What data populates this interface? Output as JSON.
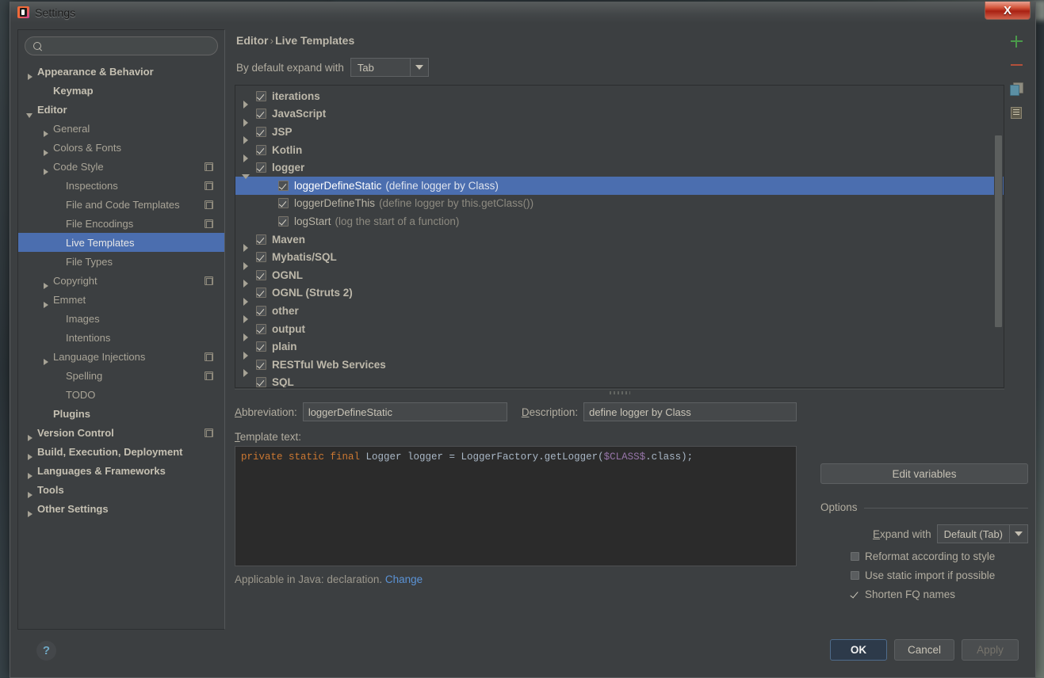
{
  "window": {
    "title": "Settings",
    "app_icon": "intellij-icon",
    "close_label": "X"
  },
  "sidebar": {
    "search": {
      "placeholder": "",
      "value": "",
      "icon": "search-icon"
    },
    "items": [
      {
        "label": "Appearance & Behavior",
        "indent": 1,
        "arrow": "closed",
        "bold": true,
        "badge": false,
        "selected": false
      },
      {
        "label": "Keymap",
        "indent": 2,
        "arrow": "none",
        "bold": true,
        "badge": false,
        "selected": false
      },
      {
        "label": "Editor",
        "indent": 1,
        "arrow": "open",
        "bold": true,
        "badge": false,
        "selected": false
      },
      {
        "label": "General",
        "indent": 2,
        "arrow": "closed",
        "bold": false,
        "badge": false,
        "selected": false
      },
      {
        "label": "Colors & Fonts",
        "indent": 2,
        "arrow": "closed",
        "bold": false,
        "badge": false,
        "selected": false
      },
      {
        "label": "Code Style",
        "indent": 2,
        "arrow": "closed",
        "bold": false,
        "badge": true,
        "selected": false
      },
      {
        "label": "Inspections",
        "indent": 3,
        "arrow": "none",
        "bold": false,
        "badge": true,
        "selected": false
      },
      {
        "label": "File and Code Templates",
        "indent": 3,
        "arrow": "none",
        "bold": false,
        "badge": true,
        "selected": false
      },
      {
        "label": "File Encodings",
        "indent": 3,
        "arrow": "none",
        "bold": false,
        "badge": true,
        "selected": false
      },
      {
        "label": "Live Templates",
        "indent": 3,
        "arrow": "none",
        "bold": false,
        "badge": false,
        "selected": true
      },
      {
        "label": "File Types",
        "indent": 3,
        "arrow": "none",
        "bold": false,
        "badge": false,
        "selected": false
      },
      {
        "label": "Copyright",
        "indent": 2,
        "arrow": "closed",
        "bold": false,
        "badge": true,
        "selected": false
      },
      {
        "label": "Emmet",
        "indent": 2,
        "arrow": "closed",
        "bold": false,
        "badge": false,
        "selected": false
      },
      {
        "label": "Images",
        "indent": 3,
        "arrow": "none",
        "bold": false,
        "badge": false,
        "selected": false
      },
      {
        "label": "Intentions",
        "indent": 3,
        "arrow": "none",
        "bold": false,
        "badge": false,
        "selected": false
      },
      {
        "label": "Language Injections",
        "indent": 2,
        "arrow": "closed",
        "bold": false,
        "badge": true,
        "selected": false
      },
      {
        "label": "Spelling",
        "indent": 3,
        "arrow": "none",
        "bold": false,
        "badge": true,
        "selected": false
      },
      {
        "label": "TODO",
        "indent": 3,
        "arrow": "none",
        "bold": false,
        "badge": false,
        "selected": false
      },
      {
        "label": "Plugins",
        "indent": 2,
        "arrow": "none",
        "bold": true,
        "badge": false,
        "selected": false
      },
      {
        "label": "Version Control",
        "indent": 1,
        "arrow": "closed",
        "bold": true,
        "badge": true,
        "selected": false
      },
      {
        "label": "Build, Execution, Deployment",
        "indent": 1,
        "arrow": "closed",
        "bold": true,
        "badge": false,
        "selected": false
      },
      {
        "label": "Languages & Frameworks",
        "indent": 1,
        "arrow": "closed",
        "bold": true,
        "badge": false,
        "selected": false
      },
      {
        "label": "Tools",
        "indent": 1,
        "arrow": "closed",
        "bold": true,
        "badge": false,
        "selected": false
      },
      {
        "label": "Other Settings",
        "indent": 1,
        "arrow": "closed",
        "bold": true,
        "badge": false,
        "selected": false
      }
    ]
  },
  "main": {
    "breadcrumb": {
      "parent": "Editor",
      "separator": "›",
      "current": "Live Templates"
    },
    "expand_with": {
      "label": "By default expand with",
      "value": "Tab"
    },
    "tree": [
      {
        "label": "iterations",
        "type": "group",
        "arrow": "closed",
        "checked": true,
        "desc": "",
        "selected": false
      },
      {
        "label": "JavaScript",
        "type": "group",
        "arrow": "closed",
        "checked": true,
        "desc": "",
        "selected": false
      },
      {
        "label": "JSP",
        "type": "group",
        "arrow": "closed",
        "checked": true,
        "desc": "",
        "selected": false
      },
      {
        "label": "Kotlin",
        "type": "group",
        "arrow": "closed",
        "checked": true,
        "desc": "",
        "selected": false
      },
      {
        "label": "logger",
        "type": "group",
        "arrow": "open",
        "checked": true,
        "desc": "",
        "selected": false
      },
      {
        "label": "loggerDefineStatic",
        "type": "leaf",
        "arrow": "none",
        "checked": true,
        "desc": "(define logger by Class)",
        "selected": true
      },
      {
        "label": "loggerDefineThis",
        "type": "leaf",
        "arrow": "none",
        "checked": true,
        "desc": "(define logger by this.getClass())",
        "selected": false
      },
      {
        "label": "logStart",
        "type": "leaf",
        "arrow": "none",
        "checked": true,
        "desc": "(log the start of a function)",
        "selected": false
      },
      {
        "label": "Maven",
        "type": "group",
        "arrow": "closed",
        "checked": true,
        "desc": "",
        "selected": false
      },
      {
        "label": "Mybatis/SQL",
        "type": "group",
        "arrow": "closed",
        "checked": true,
        "desc": "",
        "selected": false
      },
      {
        "label": "OGNL",
        "type": "group",
        "arrow": "closed",
        "checked": true,
        "desc": "",
        "selected": false
      },
      {
        "label": "OGNL (Struts 2)",
        "type": "group",
        "arrow": "closed",
        "checked": true,
        "desc": "",
        "selected": false
      },
      {
        "label": "other",
        "type": "group",
        "arrow": "closed",
        "checked": true,
        "desc": "",
        "selected": false
      },
      {
        "label": "output",
        "type": "group",
        "arrow": "closed",
        "checked": true,
        "desc": "",
        "selected": false
      },
      {
        "label": "plain",
        "type": "group",
        "arrow": "closed",
        "checked": true,
        "desc": "",
        "selected": false
      },
      {
        "label": "RESTful Web Services",
        "type": "group",
        "arrow": "closed",
        "checked": true,
        "desc": "",
        "selected": false
      },
      {
        "label": "SQL",
        "type": "group",
        "arrow": "closed",
        "checked": true,
        "desc": "",
        "selected": false
      }
    ],
    "toolbar": [
      {
        "icon": "plus-icon",
        "name": "add-template-button"
      },
      {
        "icon": "minus-icon",
        "name": "remove-template-button"
      },
      {
        "icon": "copy-icon",
        "name": "duplicate-template-button"
      },
      {
        "icon": "document-icon",
        "name": "template-group-button"
      }
    ],
    "form": {
      "abbreviation_label": "Abbreviation:",
      "abbreviation_value": "loggerDefineStatic",
      "description_label": "Description:",
      "description_value": "define logger by Class",
      "template_text_label": "Template text:",
      "template_code": {
        "keywords": "private static final ",
        "part2": "Logger logger = LoggerFactory.getLogger(",
        "variable": "$CLASS$",
        "part3": ".class);"
      },
      "applicable_text": "Applicable in Java: declaration.",
      "applicable_link": "Change"
    },
    "options": {
      "edit_variables_label": "Edit variables",
      "group_label": "Options",
      "expand_with_label": "Expand with",
      "expand_with_value": "Default (Tab)",
      "checkboxes": [
        {
          "label": "Reformat according to style",
          "checked": false
        },
        {
          "label": "Use static import if possible",
          "checked": false
        },
        {
          "label": "Shorten FQ names",
          "checked": true
        }
      ]
    }
  },
  "footer": {
    "help_label": "?",
    "ok_label": "OK",
    "cancel_label": "Cancel",
    "apply_label": "Apply"
  },
  "colors": {
    "selection": "#4b6eaf",
    "window_bg": "#3c3f41",
    "code_bg": "#2b2b2b",
    "keyword": "#cc7832",
    "variable": "#9876aa",
    "link": "#5b93d6",
    "add_icon": "#4a9a4a",
    "remove_icon": "#b3503a"
  }
}
